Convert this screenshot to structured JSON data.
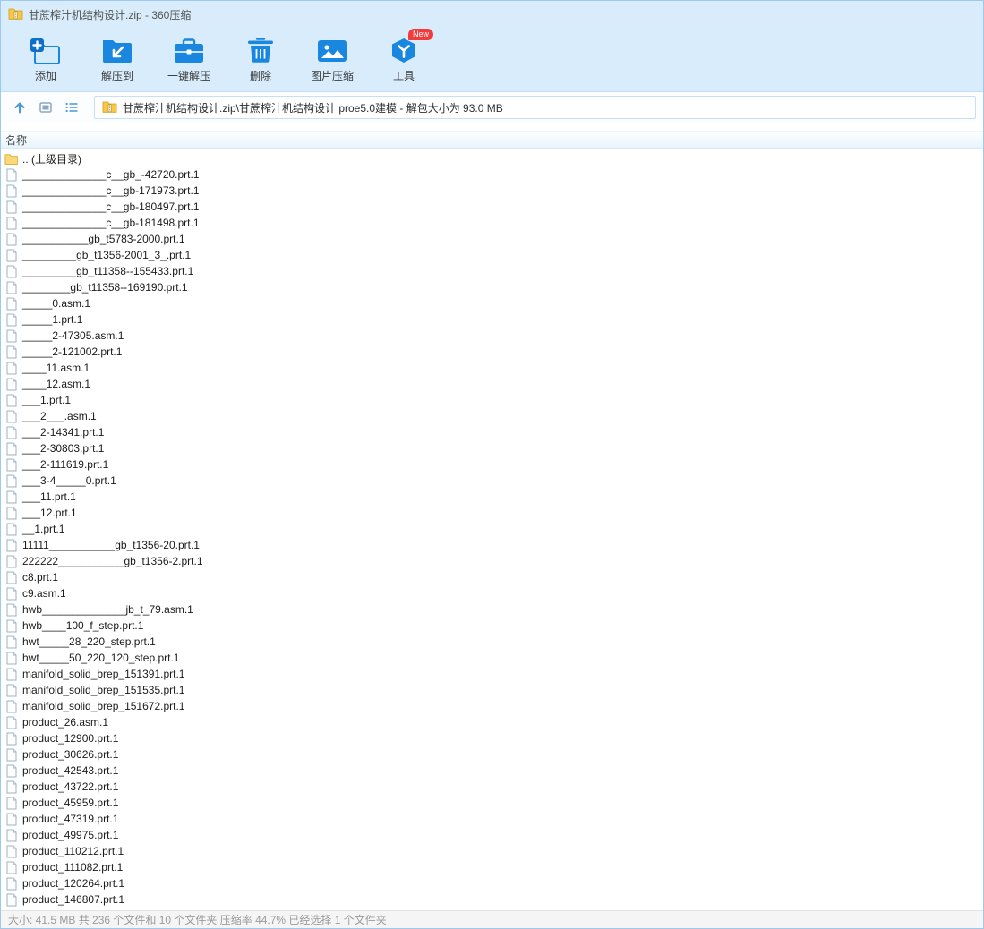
{
  "window": {
    "title": "甘蔗榨汁机结构设计.zip - 360压缩",
    "app_icon": "zip-archive-icon"
  },
  "toolbar": {
    "buttons": [
      {
        "label": "添加",
        "icon": "add-icon"
      },
      {
        "label": "解压到",
        "icon": "extract-to-icon"
      },
      {
        "label": "一键解压",
        "icon": "one-click-extract-icon"
      },
      {
        "label": "删除",
        "icon": "delete-icon"
      },
      {
        "label": "图片压缩",
        "icon": "image-compress-icon"
      },
      {
        "label": "工具",
        "icon": "tools-icon",
        "badge": "New"
      }
    ]
  },
  "navbar": {
    "icons": [
      "up-arrow-icon",
      "view-mode-icon",
      "list-view-icon"
    ],
    "address": {
      "icon": "zip-file-icon",
      "path": "甘蔗榨汁机结构设计.zip\\甘蔗榨汁机结构设计 proe5.0建模 - 解包大小为 93.0 MB"
    }
  },
  "list": {
    "column_header": "名称",
    "parent_entry": ".. (上级目录)",
    "files": [
      "______________c__gb_-42720.prt.1",
      "______________c__gb-171973.prt.1",
      "______________c__gb-180497.prt.1",
      "______________c__gb-181498.prt.1",
      "___________gb_t5783-2000.prt.1",
      "_________gb_t1356-2001_3_.prt.1",
      "_________gb_t11358--155433.prt.1",
      "________gb_t11358--169190.prt.1",
      "_____0.asm.1",
      "_____1.prt.1",
      "_____2-47305.asm.1",
      "_____2-121002.prt.1",
      "____11.asm.1",
      "____12.asm.1",
      "___1.prt.1",
      "___2___.asm.1",
      "___2-14341.prt.1",
      "___2-30803.prt.1",
      "___2-111619.prt.1",
      "___3-4_____0.prt.1",
      "___11.prt.1",
      "___12.prt.1",
      "__1.prt.1",
      "11111___________gb_t1356-20.prt.1",
      "222222___________gb_t1356-2.prt.1",
      "c8.prt.1",
      "c9.asm.1",
      "hwb______________jb_t_79.asm.1",
      "hwb____100_f_step.prt.1",
      "hwt_____28_220_step.prt.1",
      "hwt_____50_220_120_step.prt.1",
      "manifold_solid_brep_151391.prt.1",
      "manifold_solid_brep_151535.prt.1",
      "manifold_solid_brep_151672.prt.1",
      "product_26.asm.1",
      "product_12900.prt.1",
      "product_30626.prt.1",
      "product_42543.prt.1",
      "product_43722.prt.1",
      "product_45959.prt.1",
      "product_47319.prt.1",
      "product_49975.prt.1",
      "product_110212.prt.1",
      "product_111082.prt.1",
      "product_120264.prt.1",
      "product_146807.prt.1"
    ]
  },
  "statusbar": {
    "text": "大小: 41.5 MB 共 236 个文件和 10 个文件夹 压缩率 44.7% 已经选择 1 个文件夹"
  },
  "colors": {
    "titlebar_bg": "#d8ecfb",
    "icon_blue": "#1987e0",
    "badge_red": "#f23c3c",
    "folder_yellow": "#fbd978"
  }
}
